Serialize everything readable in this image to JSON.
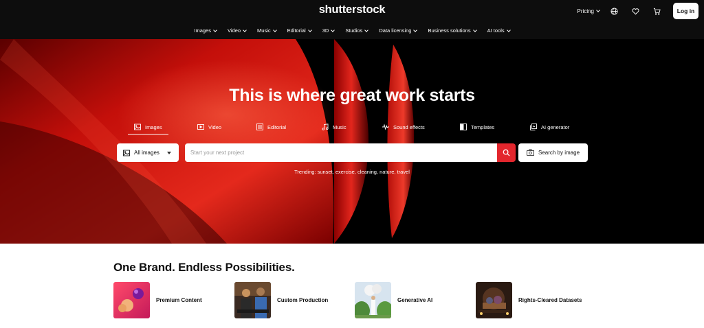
{
  "header": {
    "logo": "shutterstock",
    "pricing_label": "Pricing",
    "login_label": "Log in",
    "icons": [
      "globe-icon",
      "heart-icon",
      "cart-icon"
    ]
  },
  "nav": {
    "items": [
      {
        "label": "Images"
      },
      {
        "label": "Video"
      },
      {
        "label": "Music"
      },
      {
        "label": "Editorial"
      },
      {
        "label": "3D"
      },
      {
        "label": "Studios"
      },
      {
        "label": "Data licensing"
      },
      {
        "label": "Business solutions"
      },
      {
        "label": "AI tools"
      }
    ]
  },
  "hero": {
    "title": "This is where great work starts",
    "tabs": [
      {
        "label": "Images",
        "icon": "image-icon",
        "active": true
      },
      {
        "label": "Video",
        "icon": "video-icon"
      },
      {
        "label": "Editorial",
        "icon": "editorial-icon"
      },
      {
        "label": "Music",
        "icon": "music-note-icon"
      },
      {
        "label": "Sound effects",
        "icon": "waveform-icon"
      },
      {
        "label": "Templates",
        "icon": "template-icon"
      },
      {
        "label": "AI generator",
        "icon": "ai-generator-icon"
      }
    ],
    "search": {
      "type_selected": "All images",
      "placeholder": "Start your next project",
      "value": "",
      "by_image_label": "Search by image"
    },
    "trending": {
      "label": "Trending:",
      "items": [
        "sunset,",
        "exercise,",
        "cleaning,",
        "nature,",
        "travel"
      ]
    }
  },
  "section": {
    "title": "One Brand. Endless Possibilities.",
    "cards": [
      {
        "label": "Premium Content"
      },
      {
        "label": "Custom Production"
      },
      {
        "label": "Generative AI"
      },
      {
        "label": "Rights-Cleared Datasets"
      }
    ]
  },
  "colors": {
    "header_bg": "#0d0d0d",
    "accent_red": "#e3262d",
    "hero_bg": "#000000"
  }
}
